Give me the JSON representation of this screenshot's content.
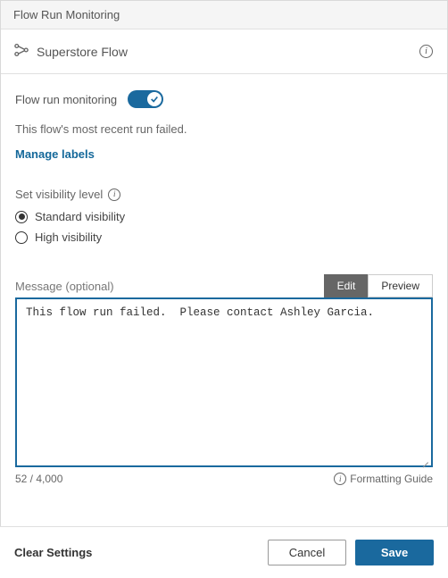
{
  "header": {
    "title": "Flow Run Monitoring"
  },
  "subheader": {
    "flow_name": "Superstore Flow"
  },
  "toggle": {
    "label": "Flow run monitoring",
    "on": true
  },
  "status": {
    "text": "This flow's most recent run failed."
  },
  "links": {
    "manage_labels": "Manage labels"
  },
  "visibility": {
    "label": "Set visibility level",
    "options": [
      {
        "label": "Standard visibility",
        "selected": true
      },
      {
        "label": "High visibility",
        "selected": false
      }
    ]
  },
  "message": {
    "label": "Message (optional)",
    "tabs": {
      "edit": "Edit",
      "preview": "Preview",
      "active": "edit"
    },
    "value": "This flow run failed.  Please contact Ashley Garcia.",
    "char_count": "52 / 4,000",
    "formatting_guide": "Formatting Guide"
  },
  "footer": {
    "clear": "Clear Settings",
    "cancel": "Cancel",
    "save": "Save"
  }
}
